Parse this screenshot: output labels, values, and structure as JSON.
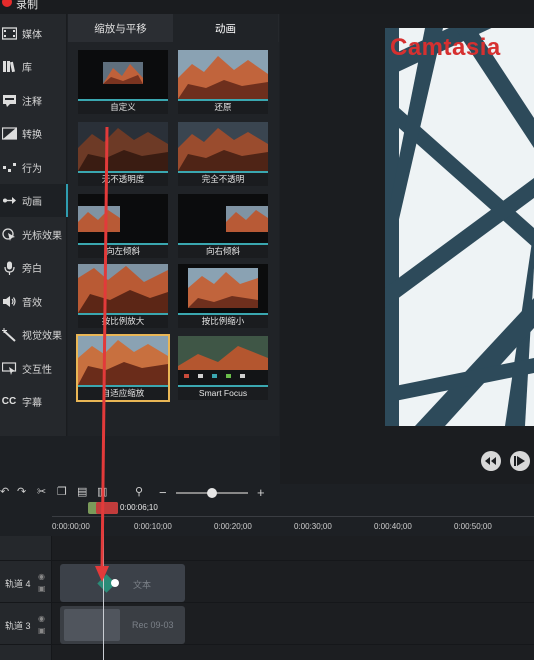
{
  "title_bar": {
    "label": "录制"
  },
  "sidebar": {
    "items": [
      {
        "label": "媒体",
        "icon": "media-icon"
      },
      {
        "label": "库",
        "icon": "library-icon"
      },
      {
        "label": "注释",
        "icon": "annotation-icon"
      },
      {
        "label": "转换",
        "icon": "transition-icon"
      },
      {
        "label": "行为",
        "icon": "behavior-icon"
      },
      {
        "label": "动画",
        "icon": "animation-icon",
        "active": true
      },
      {
        "label": "光标效果",
        "icon": "cursor-effect-icon"
      },
      {
        "label": "旁白",
        "icon": "microphone-icon"
      },
      {
        "label": "音效",
        "icon": "speaker-icon"
      },
      {
        "label": "视觉效果",
        "icon": "magic-wand-icon"
      },
      {
        "label": "交互性",
        "icon": "interactive-icon"
      },
      {
        "label": "字幕",
        "icon": "captions-icon"
      }
    ]
  },
  "panel": {
    "tabs": [
      {
        "label": "缩放与平移",
        "active": false
      },
      {
        "label": "动画",
        "active": true
      }
    ],
    "animations": [
      {
        "label": "自定义"
      },
      {
        "label": "还原"
      },
      {
        "label": "无不透明度"
      },
      {
        "label": "完全不透明"
      },
      {
        "label": "向左倾斜"
      },
      {
        "label": "向右倾斜"
      },
      {
        "label": "按比例放大"
      },
      {
        "label": "按比例缩小"
      },
      {
        "label": "自适应缩放",
        "selected": true
      },
      {
        "label": "Smart Focus"
      }
    ]
  },
  "preview": {
    "watermark": "Camtasia"
  },
  "timeline": {
    "playhead_time": "0:00:06;10",
    "ticks": [
      "0:00:00;00",
      "0:00:10;00",
      "0:00:20;00",
      "0:00:30;00",
      "0:00:40;00",
      "0:00:50;00"
    ],
    "tracks": [
      {
        "name": "轨道 4",
        "clip_label": "文本"
      },
      {
        "name": "轨道 3",
        "clip_label": "Rec 09-03"
      }
    ]
  },
  "colors": {
    "accent_teal": "#2f9db0",
    "selection_gold": "#e9b655",
    "annotation_red": "#e23a3a",
    "watermark_red": "#d63030"
  }
}
